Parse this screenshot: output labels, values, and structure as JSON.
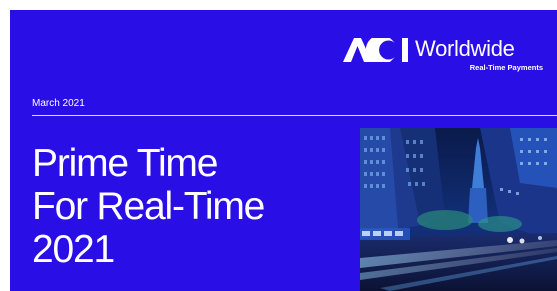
{
  "brand": {
    "name": "Worldwide",
    "logo_mark": "ACI",
    "tagline": "Real-Time Payments"
  },
  "report": {
    "date": "March 2021",
    "title_lines": [
      "Prime Time",
      "For Real-Time",
      "2021"
    ]
  },
  "colors": {
    "background": "#2a0ee6",
    "text": "#ffffff"
  },
  "image": {
    "icon": "city-street-night-photo"
  }
}
